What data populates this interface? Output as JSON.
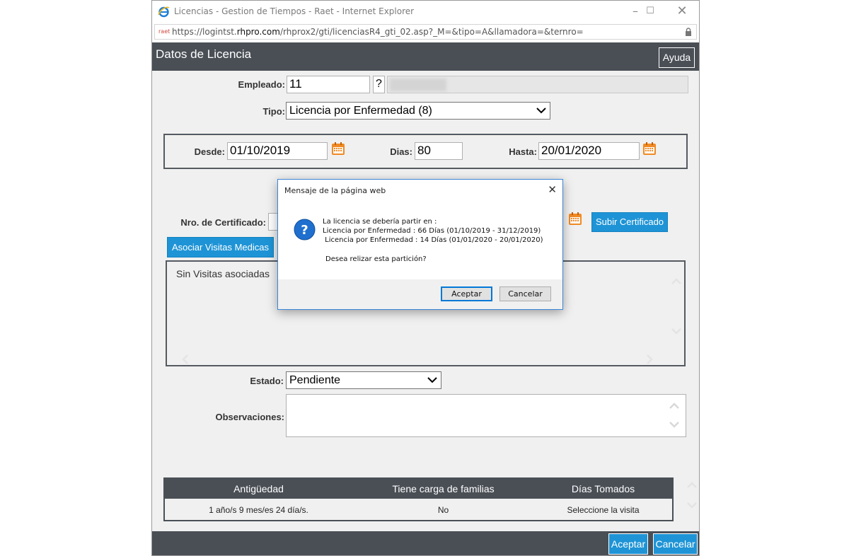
{
  "window": {
    "title": "Licencias - Gestion de Tiempos - Raet - Internet Explorer",
    "url_prefix": "https://logintst.",
    "url_domain": "rhpro.com",
    "url_rest": "/rhprox2/gti/licenciasR4_gti_02.asp?_M=&tipo=A&llamadora=&ternro=",
    "addr_icon": "raet"
  },
  "header": {
    "title": "Datos de Licencia",
    "help_label": "Ayuda"
  },
  "form": {
    "empleado_label": "Empleado:",
    "empleado_value": "11",
    "empleado_search": "?",
    "tipo_label": "Tipo:",
    "tipo_value": "Licencia por Enfermedad (8)",
    "desde_label": "Desde:",
    "desde_value": "01/10/2019",
    "dias_label": "Dias:",
    "dias_value": "80",
    "hasta_label": "Hasta:",
    "hasta_value": "20/01/2020",
    "certificado_label": "Nro. de Certificado:",
    "subir_certificado": "Subir Certificado",
    "asociar_visitas": "Asociar Visitas Medicas",
    "sin_visitas": "Sin Visitas asociadas",
    "estado_label": "Estado:",
    "estado_value": "Pendiente",
    "observaciones_label": "Observaciones:"
  },
  "table": {
    "headers": [
      "Antigüedad",
      "Tiene carga de familias",
      "Días Tomados"
    ],
    "row": [
      "1 año/s 9 mes/es 24 día/s.",
      "No",
      "Seleccione la visita"
    ]
  },
  "footer": {
    "accept": "Aceptar",
    "cancel": "Cancelar"
  },
  "dialog": {
    "title": "Mensaje de la página web",
    "line1": "La licencia se debería partir en :",
    "line2": "Licencia por Enfermedad : 66 Días (01/10/2019 - 31/12/2019)",
    "line3": " Licencia por Enfermedad : 14 Días (01/01/2020 - 20/01/2020)",
    "question": "Desea relizar esta partición?",
    "accept": "Aceptar",
    "cancel": "Cancelar"
  },
  "colors": {
    "header_bg": "#4a4f56",
    "accent_blue": "#1e94d6",
    "calendar_orange": "#f08a24",
    "dialog_border": "#3a86d8"
  }
}
